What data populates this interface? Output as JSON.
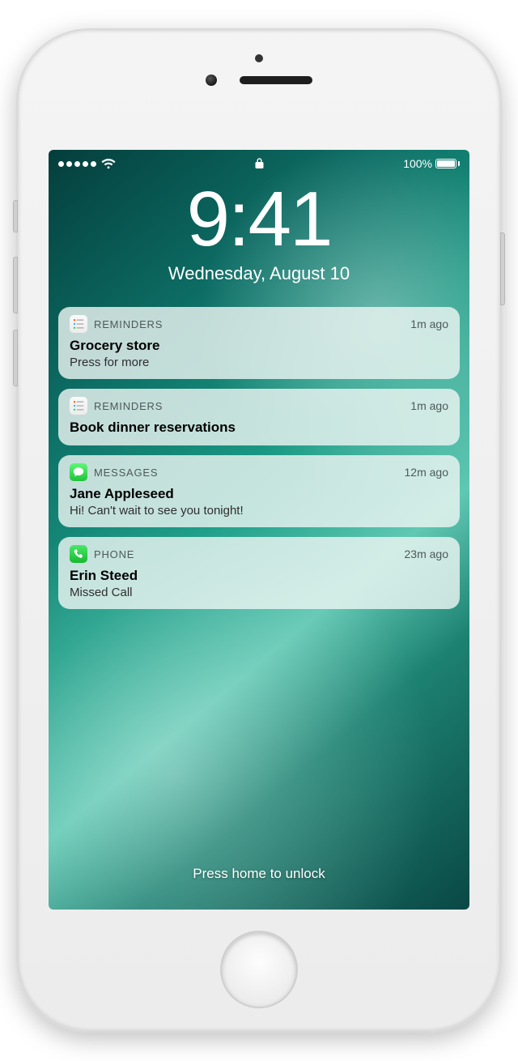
{
  "status": {
    "battery_text": "100%"
  },
  "clock": {
    "time": "9:41",
    "date": "Wednesday, August 10"
  },
  "notifications": [
    {
      "app": "REMINDERS",
      "icon": "reminders",
      "time": "1m ago",
      "title": "Grocery store",
      "body": "Press for more"
    },
    {
      "app": "REMINDERS",
      "icon": "reminders",
      "time": "1m ago",
      "title": "Book dinner reservations",
      "body": ""
    },
    {
      "app": "MESSAGES",
      "icon": "messages",
      "time": "12m ago",
      "title": "Jane Appleseed",
      "body": "Hi! Can't wait to see you tonight!"
    },
    {
      "app": "PHONE",
      "icon": "phone",
      "time": "23m ago",
      "title": "Erin Steed",
      "body": "Missed Call"
    }
  ],
  "unlock_hint": "Press home to unlock"
}
